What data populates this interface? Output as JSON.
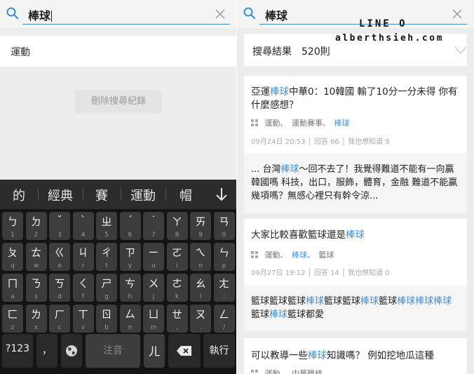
{
  "left": {
    "search": {
      "query": "棒球"
    },
    "history": {
      "item": "運動",
      "clear_label": "刪除搜尋紀錄"
    },
    "keyboard": {
      "candidates": [
        "的",
        "經典",
        "賽",
        "運動",
        "帽"
      ],
      "rows": [
        [
          [
            "ㄅ",
            "1"
          ],
          [
            "ㄉ",
            "2"
          ],
          [
            "ˇ",
            "3"
          ],
          [
            "ˋ",
            "4"
          ],
          [
            "ㄓ",
            "5"
          ],
          [
            "ˊ",
            "6"
          ],
          [
            "˙",
            "7"
          ],
          [
            "ㄚ",
            "8"
          ],
          [
            "ㄞ",
            "9"
          ],
          [
            "ㄢ",
            "0"
          ]
        ],
        [
          [
            "ㄆ",
            "q"
          ],
          [
            "ㄊ",
            "w"
          ],
          [
            "ㄍ",
            "e"
          ],
          [
            "ㄐ",
            "r"
          ],
          [
            "ㄔ",
            "t"
          ],
          [
            "ㄗ",
            "y"
          ],
          [
            "ㄧ",
            "u"
          ],
          [
            "ㄛ",
            "i"
          ],
          [
            "ㄟ",
            "o"
          ],
          [
            "ㄣ",
            "p"
          ]
        ],
        [
          [
            "ㄇ",
            "a"
          ],
          [
            "ㄋ",
            "s"
          ],
          [
            "ㄎ",
            "d"
          ],
          [
            "ㄑ",
            "f"
          ],
          [
            "ㄕ",
            "g"
          ],
          [
            "ㄘ",
            "h"
          ],
          [
            "ㄨ",
            "j"
          ],
          [
            "ㄜ",
            "k"
          ],
          [
            "ㄠ",
            "l"
          ],
          [
            "ㄤ",
            ";"
          ]
        ],
        [
          [
            "ㄈ",
            "z"
          ],
          [
            "ㄌ",
            "x"
          ],
          [
            "ㄏ",
            "c"
          ],
          [
            "ㄒ",
            "v"
          ],
          [
            "ㄖ",
            "b"
          ],
          [
            "ㄙ",
            "n"
          ],
          [
            "ㄩ",
            "m"
          ],
          [
            "ㄝ",
            ","
          ],
          [
            "ㄡ",
            "."
          ],
          [
            "ㄥ",
            "/"
          ]
        ]
      ],
      "mode_label": "?123",
      "punct_label": "，",
      "space_label": "注音",
      "er_label": "ㄦ",
      "enter_label": "執行"
    }
  },
  "right": {
    "search": {
      "query": "棒球"
    },
    "watermark": {
      "line1": "LINE O",
      "line2": "alberthsieh.com"
    },
    "result_count": "搜尋結果　520則",
    "cards": [
      {
        "question_parts": [
          [
            "亞運",
            false
          ],
          [
            "棒球",
            true
          ],
          [
            "中華0：10韓國 輸了10分一分未得 你有什麼感想？",
            false
          ]
        ],
        "tags": [
          [
            "運動",
            false
          ],
          [
            "運動賽事",
            false
          ],
          [
            "棒球",
            true
          ]
        ],
        "meta": "09月24日 20:53 │ 回答 66 │ 我也想知道 9",
        "answer_parts": [
          [
            "... 台灣",
            false
          ],
          [
            "棒球",
            true
          ],
          [
            "～回不去了！我覺得難道不能有一向贏韓國嗎 科技，出口，服飾，體育，金融 難道不能贏幾項嗎？無感心裡只有幹令涼...",
            false
          ]
        ]
      },
      {
        "question_parts": [
          [
            "大家比較喜歡籃球還是",
            false
          ],
          [
            "棒球",
            true
          ]
        ],
        "tags": [
          [
            "運動",
            false
          ],
          [
            "棒球",
            true
          ],
          [
            "籃球",
            false
          ]
        ],
        "meta": "09月27日 19:12 │ 回答 14 │ 我也想知道 0",
        "answer_parts": [
          [
            "籃球籃球籃球",
            false
          ],
          [
            "棒球",
            true
          ],
          [
            "籃球籃球",
            false
          ],
          [
            "棒球",
            true
          ],
          [
            "籃球",
            false
          ],
          [
            "棒球棒球棒球",
            true
          ],
          [
            "籃球",
            false
          ],
          [
            "棒球",
            true
          ],
          [
            "籃球都愛",
            false
          ]
        ]
      },
      {
        "question_parts": [
          [
            "可以教導一些",
            false
          ],
          [
            "棒球",
            true
          ],
          [
            "知識嗎？ 例如挖地瓜這種",
            false
          ]
        ],
        "tags": [
          [
            "運動",
            false
          ],
          [
            "中華職棒",
            false
          ]
        ]
      }
    ]
  }
}
